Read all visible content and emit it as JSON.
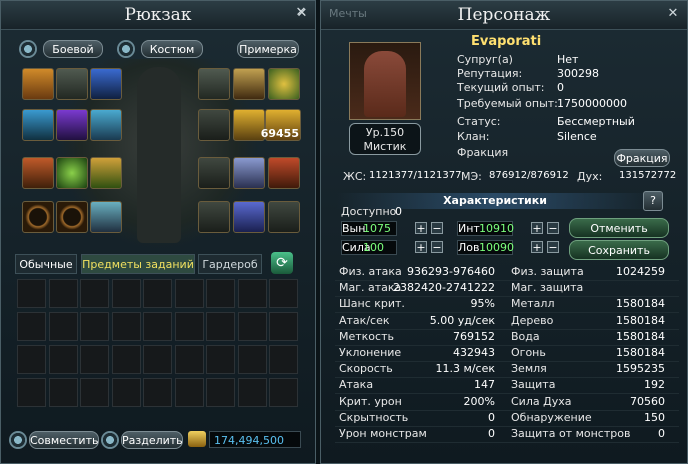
{
  "backpack": {
    "title": "Рюкзак",
    "mode_combat": "Боевой",
    "mode_costume": "Костюм",
    "fitting": "Примерка",
    "item_count_badge": "69455",
    "tabs": [
      "Обычные",
      "Предметы заданий",
      "Гардероб"
    ],
    "combine": "Совместить",
    "split": "Разделить",
    "money": "174,494,500"
  },
  "background_text": "Мечты",
  "character": {
    "title": "Персонаж",
    "name": "Evaporati",
    "level": "Ур.150",
    "class": "Мистик",
    "faction_button": "Фракция",
    "info": [
      {
        "label": "Супруг(а)",
        "value": "Нет"
      },
      {
        "label": "Репутация:",
        "value": "300298"
      },
      {
        "label": "Текущий опыт:",
        "value": "0"
      },
      {
        "label": "Требуемый опыт:",
        "value": "1750000000"
      },
      {
        "label": "Статус:",
        "value": "Бессмертный"
      },
      {
        "label": "Клан:",
        "value": "Silence"
      },
      {
        "label": "Фракция",
        "value": ""
      }
    ],
    "hp_label": "ЖС:",
    "hp": "1121377/1121377",
    "mp_label": "МЭ:",
    "mp": "876912/876912",
    "spirit_label": "Дух:",
    "spirit": "131572772"
  },
  "characteristics": {
    "header": "Характеристики",
    "help": "?",
    "available_label": "Доступно",
    "available": "0",
    "stats": [
      {
        "label": "Вын",
        "value": "1075"
      },
      {
        "label": "Инт",
        "value": "10910"
      },
      {
        "label": "Сила",
        "value": "100"
      },
      {
        "label": "Лов",
        "value": "10090"
      }
    ],
    "cancel": "Отменить",
    "save": "Сохранить"
  },
  "combat_stats": {
    "left": [
      {
        "label": "Физ. атака",
        "value": "936293-976460"
      },
      {
        "label": "Маг. атака",
        "value": "2382420-2741222"
      },
      {
        "label": "Шанс крит.",
        "value": "95%"
      },
      {
        "label": "Атак/сек",
        "value": "5.00 уд/сек"
      },
      {
        "label": "Меткость",
        "value": "769152"
      },
      {
        "label": "Уклонение",
        "value": "432943"
      },
      {
        "label": "Скорость",
        "value": "11.3 м/сек"
      },
      {
        "label": "Атака",
        "value": "147"
      },
      {
        "label": "Крит. урон",
        "value": "200%"
      },
      {
        "label": "Скрытность",
        "value": "0"
      },
      {
        "label": "Урон монстрам",
        "value": "0"
      }
    ],
    "right": [
      {
        "label": "Физ. защита",
        "value": "1024259"
      },
      {
        "label": "Маг. защита",
        "value": ""
      },
      {
        "label": "Металл",
        "value": "1580184"
      },
      {
        "label": "Дерево",
        "value": "1580184"
      },
      {
        "label": "Вода",
        "value": "1580184"
      },
      {
        "label": "Огонь",
        "value": "1580184"
      },
      {
        "label": "Земля",
        "value": "1595235"
      },
      {
        "label": "Защита",
        "value": "192"
      },
      {
        "label": "Сила Духа",
        "value": "70560"
      },
      {
        "label": "Обнаружение",
        "value": "150"
      },
      {
        "label": "Защита от монстров",
        "value": "0"
      }
    ]
  },
  "icons": {
    "close": "close-icon",
    "gear": "gear-icon",
    "refresh": "refresh-icon",
    "chest": "chest-icon",
    "coin": "coin-icon"
  },
  "colors": {
    "accent_gold": "#f0c040",
    "stat_value_green": "#7cff7c",
    "title_yellow": "#ffe070"
  }
}
